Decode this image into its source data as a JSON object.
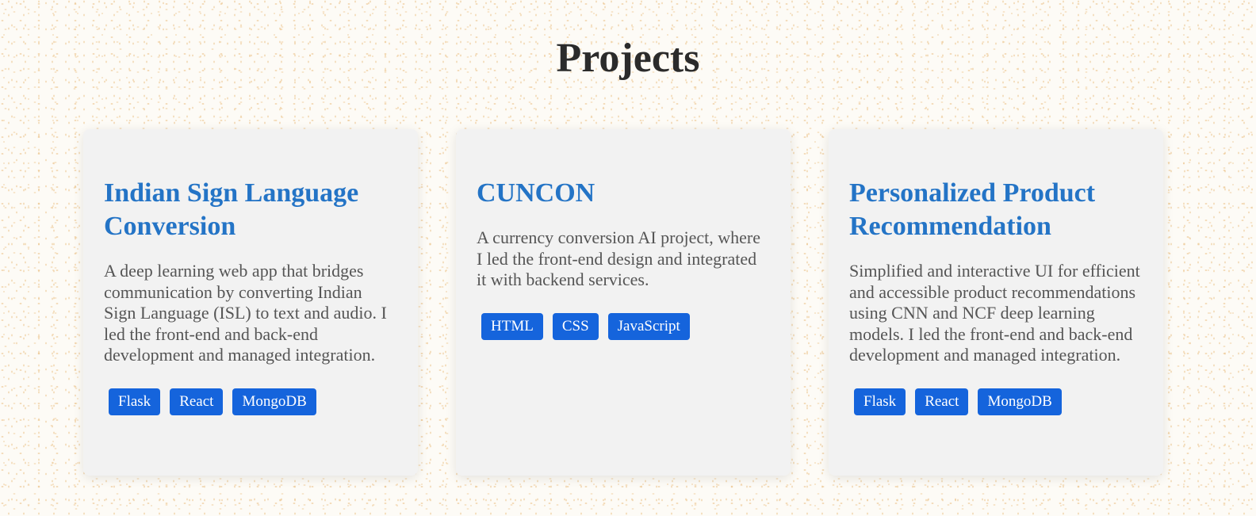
{
  "section": {
    "title": "Projects"
  },
  "projects": [
    {
      "title": "Indian Sign Language Conversion",
      "description": "A deep learning web app that bridges communication by converting Indian Sign Language (ISL) to text and audio. I led the front-end and back-end development and managed integration.",
      "tags": [
        "Flask",
        "React",
        "MongoDB"
      ]
    },
    {
      "title": "CUNCON",
      "description": "A currency conversion AI project, where I led the front-end design and integrated it with backend services.",
      "tags": [
        "HTML",
        "CSS",
        "JavaScript"
      ]
    },
    {
      "title": "Personalized Product Recommendation",
      "description": "Simplified and interactive UI for efficient and accessible product recommendations using CNN and NCF deep learning models. I led the front-end and back-end development and managed integration.",
      "tags": [
        "Flask",
        "React",
        "MongoDB"
      ]
    }
  ],
  "colors": {
    "heading_accent": "#2474c6",
    "tag_background": "#1564dc",
    "card_background": "#f2f2f2",
    "page_title": "#2b2b2b"
  }
}
